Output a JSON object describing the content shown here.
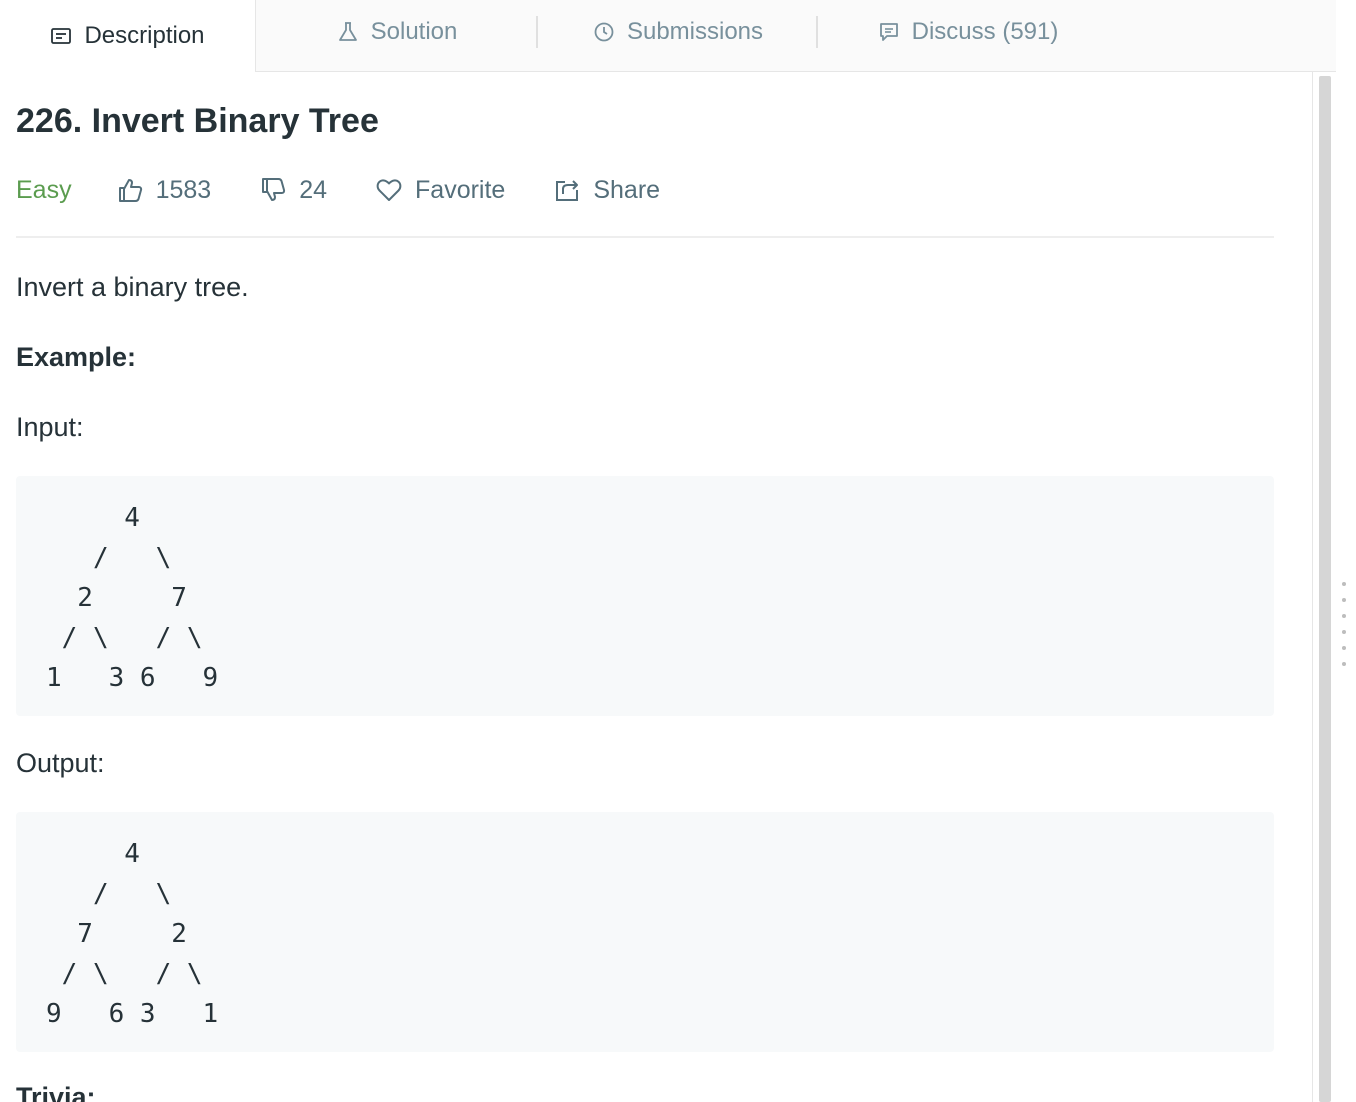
{
  "tabs": [
    {
      "label": "Description",
      "icon": "description-icon"
    },
    {
      "label": "Solution",
      "icon": "flask-icon"
    },
    {
      "label": "Submissions",
      "icon": "clock-icon"
    },
    {
      "label": "Discuss (591)",
      "icon": "comment-icon"
    }
  ],
  "problem": {
    "title": "226. Invert Binary Tree",
    "difficulty": "Easy",
    "difficulty_color": "#5b9c4f",
    "likes": "1583",
    "dislikes": "24",
    "favorite_label": "Favorite",
    "share_label": "Share"
  },
  "body": {
    "intro": "Invert a binary tree.",
    "example_heading": "Example:",
    "input_label": "Input:",
    "input_tree": "     4\n   /   \\\n  2     7\n / \\   / \\\n1   3 6   9",
    "output_label": "Output:",
    "output_tree": "     4\n   /   \\\n  7     2\n / \\   / \\\n9   6 3   1",
    "trivia_heading": "Trivia:"
  }
}
